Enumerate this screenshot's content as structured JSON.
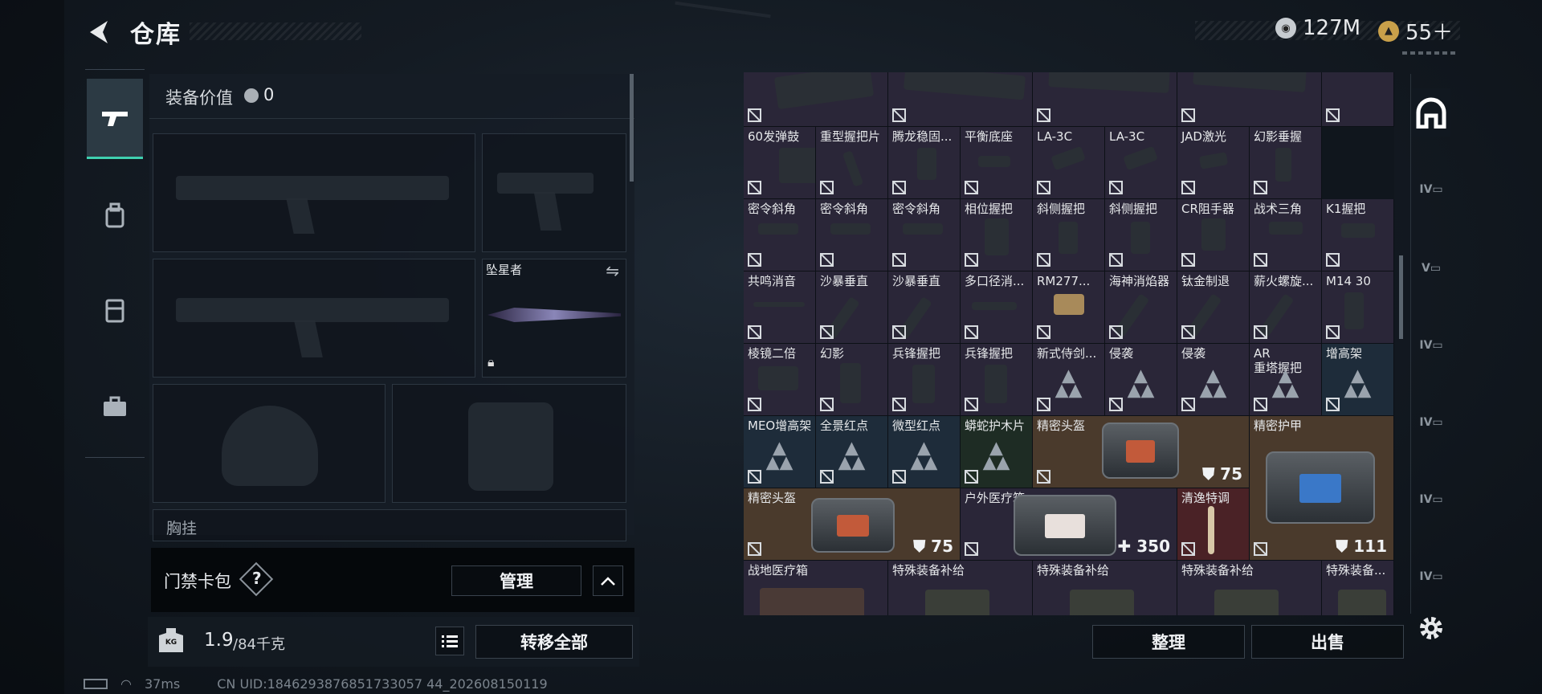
{
  "header": {
    "title": "仓库",
    "currency1": "127M",
    "currency2": "55＋"
  },
  "loadout": {
    "value_label": "装备价值",
    "value": "0",
    "melee_name": "坠星者",
    "chest_label": "胸挂"
  },
  "keycard": {
    "label": "门禁卡包",
    "help": "?",
    "manage": "管理"
  },
  "weight": {
    "current": "1.9",
    "max": "/84千克",
    "kg": "KG",
    "transfer_all": "转移全部"
  },
  "stash": {
    "sort": "整理",
    "sell": "出售",
    "rows": [
      [
        "",
        "",
        "",
        "",
        "",
        ""
      ],
      [
        "60发弹鼓",
        "重型握把片",
        "腾龙稳固...",
        "平衡底座",
        "LA-3C",
        "LA-3C",
        "JAD激光",
        "幻影垂握"
      ],
      [
        "密令斜角",
        "密令斜角",
        "密令斜角",
        "相位握把",
        "斜侧握把",
        "斜侧握把",
        "CR阻手器",
        "战术三角",
        "K1握把"
      ],
      [
        "共鸣消音",
        "沙暴垂直",
        "沙暴垂直",
        "多口径消...",
        "RM277...",
        "海神消焰器",
        "钛金制退",
        "薪火螺旋...",
        "M14 30"
      ],
      [
        "棱镜二倍",
        "幻影",
        "兵锋握把",
        "兵锋握把",
        "新式侍剑...",
        "侵袭",
        "侵袭",
        "AR\n重塔握把",
        "增高架"
      ],
      [
        "MEO增高架",
        "全景红点",
        "微型红点",
        "蟒蛇护木片",
        "精密头盔",
        "精密护甲"
      ],
      [
        "精密头盔",
        "户外医疗箱",
        "清逸特调"
      ],
      [
        "战地医疗箱",
        "特殊装备补给",
        "特殊装备补给",
        "特殊装备补给",
        "特殊装备..."
      ]
    ],
    "badges": {
      "helmet1": "75",
      "armor": "111",
      "helmet2": "75",
      "medkit": "350"
    }
  },
  "status": {
    "ping": "37ms",
    "uid": "CN UID:1846293876851733057 44_202608150119"
  },
  "colors": {
    "accent": "#3fd0b0",
    "brown": "#4a3a2c",
    "purple": "#2a2638",
    "blue": "#1e2c3a",
    "red": "#4a2226",
    "green": "#1e2c24"
  },
  "icons": [
    "back-arrow-icon",
    "pistol-icon",
    "backpack-icon",
    "vest-icon",
    "briefcase-icon",
    "weight-icon",
    "list-icon",
    "chevron-up-icon",
    "settings-icon",
    "shield-icon",
    "medical-cross-icon",
    "no-trade-icon"
  ]
}
